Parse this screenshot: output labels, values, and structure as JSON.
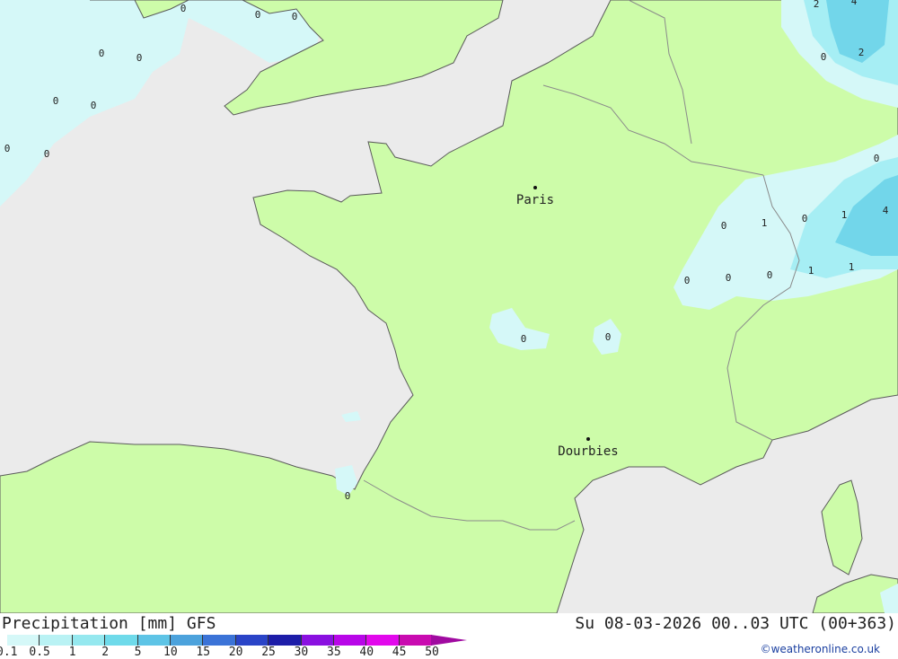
{
  "colors": {
    "sea": "#ebebeb",
    "land": "#cdfca9",
    "precip_light": "#d5f8f8",
    "precip_mid": "#a6eef4",
    "precip_high": "#72d6ea",
    "border": "#8a8a8a",
    "coast": "#5a5a5a"
  },
  "title": {
    "left": "Precipitation [mm] GFS",
    "right": "Su 08-03-2026 00..03 UTC (00+363)"
  },
  "legend": {
    "labels": [
      "0.1",
      "0.5",
      "1",
      "2",
      "5",
      "10",
      "15",
      "20",
      "25",
      "30",
      "35",
      "40",
      "45",
      "50"
    ],
    "colors": [
      "#d5f8f8",
      "#b9f2f4",
      "#95e8ef",
      "#6fdaea",
      "#5ec4e6",
      "#4ca2dc",
      "#3b73d7",
      "#2a44c7",
      "#1d1da8",
      "#8a10e0",
      "#b806e8",
      "#e208ec",
      "#c90bb0",
      "#a00aa0"
    ]
  },
  "credit": "©weatheronline.co.uk",
  "cities": [
    {
      "name": "Paris"
    },
    {
      "name": "Dourbies"
    }
  ],
  "value_labels": [
    "0",
    "0",
    "0",
    "0",
    "0",
    "0",
    "0",
    "0",
    "0",
    "0",
    "2",
    "4",
    "0",
    "2",
    "0",
    "0",
    "1",
    "0",
    "1",
    "4",
    "0",
    "0",
    "0",
    "1",
    "1",
    "0",
    "0",
    "0"
  ]
}
